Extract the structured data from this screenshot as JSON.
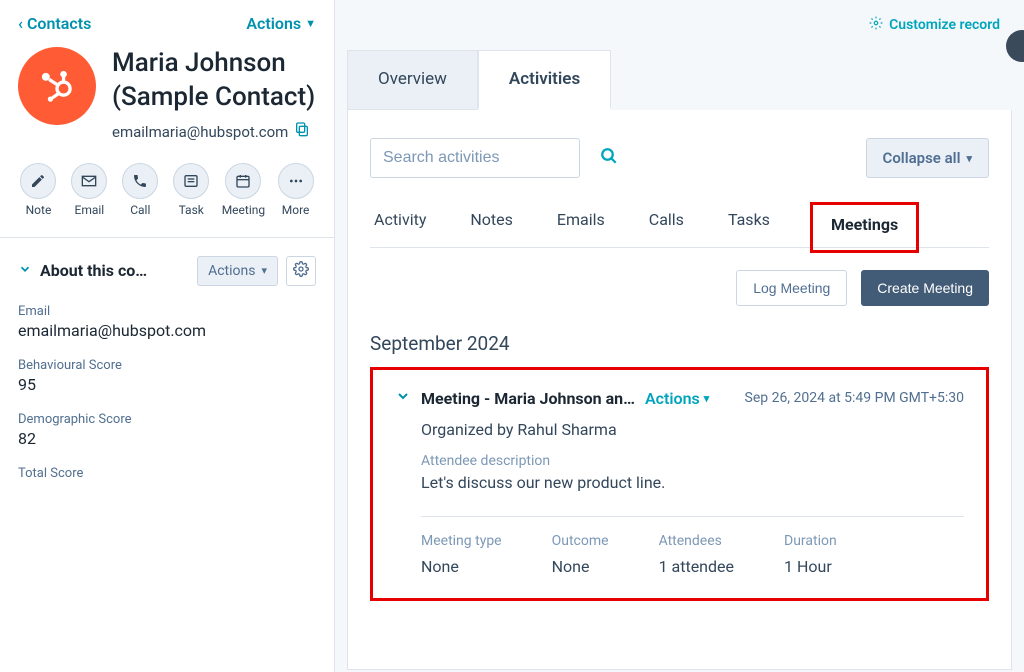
{
  "sidebar": {
    "back_label": "Contacts",
    "actions_label": "Actions",
    "contact_name": "Maria Johnson (Sample Contact)",
    "contact_email": "emailmaria@hubspot.com",
    "quick_actions": [
      {
        "name": "note-action",
        "label": "Note",
        "icon": "pencil"
      },
      {
        "name": "email-action",
        "label": "Email",
        "icon": "envelope"
      },
      {
        "name": "call-action",
        "label": "Call",
        "icon": "phone"
      },
      {
        "name": "task-action",
        "label": "Task",
        "icon": "list"
      },
      {
        "name": "meeting-action",
        "label": "Meeting",
        "icon": "calendar"
      },
      {
        "name": "more-action",
        "label": "More",
        "icon": "dots"
      }
    ],
    "about_title": "About this co…",
    "about_actions_label": "Actions",
    "fields": [
      {
        "label": "Email",
        "value": "emailmaria@hubspot.com"
      },
      {
        "label": "Behavioural Score",
        "value": "95"
      },
      {
        "label": "Demographic Score",
        "value": "82"
      },
      {
        "label": "Total Score",
        "value": ""
      }
    ]
  },
  "main": {
    "customize_label": "Customize record",
    "tabs": [
      {
        "label": "Overview",
        "active": false
      },
      {
        "label": "Activities",
        "active": true
      }
    ],
    "search_placeholder": "Search activities",
    "collapse_label": "Collapse all",
    "sub_tabs": [
      {
        "label": "Activity",
        "active": false
      },
      {
        "label": "Notes",
        "active": false
      },
      {
        "label": "Emails",
        "active": false
      },
      {
        "label": "Calls",
        "active": false
      },
      {
        "label": "Tasks",
        "active": false
      },
      {
        "label": "Meetings",
        "active": true
      }
    ],
    "log_meeting_label": "Log Meeting",
    "create_meeting_label": "Create Meeting",
    "month_label": "September 2024",
    "card": {
      "title": "Meeting - Maria Johnson an…",
      "actions_label": "Actions",
      "timestamp": "Sep 26, 2024 at 5:49 PM GMT+5:30",
      "organizer": "Organized by Rahul Sharma",
      "attendee_desc_label": "Attendee description",
      "attendee_desc": "Let's discuss our new product line.",
      "meta": [
        {
          "label": "Meeting type",
          "value": "None"
        },
        {
          "label": "Outcome",
          "value": "None"
        },
        {
          "label": "Attendees",
          "value": "1 attendee"
        },
        {
          "label": "Duration",
          "value": "1 Hour"
        }
      ]
    }
  }
}
